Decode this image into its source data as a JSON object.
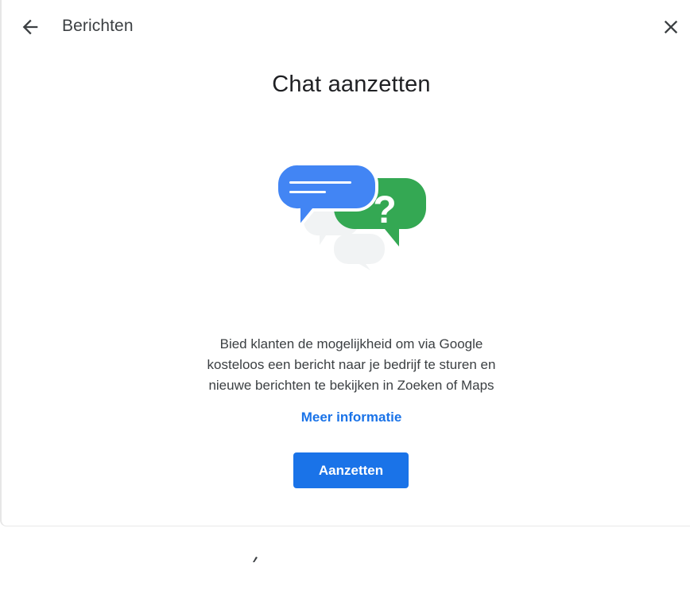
{
  "header": {
    "title": "Berichten",
    "back_icon": "arrow-back-icon",
    "close_icon": "close-icon"
  },
  "main": {
    "title": "Chat aanzetten",
    "illustration_icon": "chat-bubbles-icon",
    "illustration_symbol": "?",
    "description_lines": [
      "Bied klanten de mogelijkheid om via Google",
      "kosteloos een bericht naar je bedrijf te sturen en",
      "nieuwe berichten te bekijken in Zoeken of Maps"
    ],
    "learn_more_label": "Meer informatie",
    "primary_button_label": "Aanzetten"
  },
  "colors": {
    "accent": "#1a73e8",
    "bubble_blue": "#4285f4",
    "bubble_green": "#34a853",
    "bubble_grey": "#f1f3f4"
  }
}
